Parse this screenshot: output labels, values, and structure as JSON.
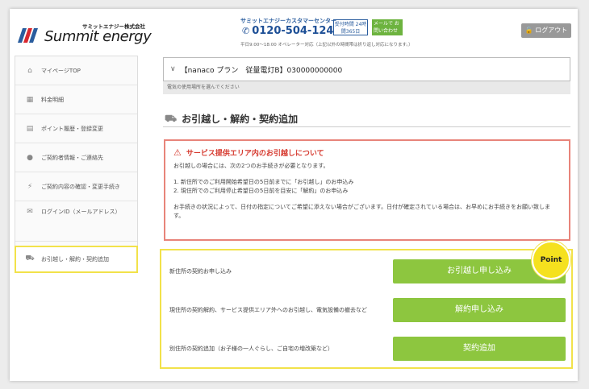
{
  "header": {
    "logo_kana": "サミットエナジー株式会社",
    "logo_brand": "Summit energy",
    "call_center_title": "サミットエナジーカスタマーセンター",
    "phone": "0120-504-124",
    "hours_badge": "受付時間 24時間365日",
    "mail_button": "メールで お問い合わせ",
    "hours_note": "平日9:00～18:00 オペレーター対応（上記以外の時間帯は折り返し対応になります。）",
    "logout_label": "ログアウト"
  },
  "sidebar": {
    "items": [
      {
        "icon": "home-icon",
        "label": "マイページTOP"
      },
      {
        "icon": "bar-chart-icon",
        "label": "料金明細"
      },
      {
        "icon": "card-icon",
        "label": "ポイント履歴・登録変更"
      },
      {
        "icon": "person-icon",
        "label": "ご契約者情報・ご連絡先"
      },
      {
        "icon": "lightning-icon",
        "label": "ご契約内容の確認・変更手続き"
      },
      {
        "icon": "mail-icon",
        "label": "ログインID（メールアドレス）"
      },
      {
        "icon": "truck-icon",
        "label": "お引越し・解約・契約追加"
      }
    ]
  },
  "contract": {
    "selected": "【nanaco プラン　従量電灯B】030000000000",
    "hint": "電気の使用場所を選んでください"
  },
  "page_title": "お引越し・解約・契約追加",
  "notice": {
    "heading": "サービス提供エリア内のお引越しについて",
    "lead": "お引越しの場合には、次の2つのお手続きが必要となります。",
    "list_1": "1. 新住所でのご利用開始希望日の5日前までに「お引越し」のお申込み",
    "list_2": "2. 現住所でのご利用停止希望日の5日前を目安に「解約」のお申込み",
    "foot": "お手続きの状況によって、日付の指定についてご希望に添えない場合がございます。日付が確定されている場合は、お早めにお手続きをお願い致します。"
  },
  "actions": [
    {
      "label": "新住所の契約お申し込み",
      "button": "お引越し申し込み"
    },
    {
      "label": "現住所の契約解約、サービス提供エリア外へのお引越し、電気設備の撤去など",
      "button": "解約申し込み"
    },
    {
      "label": "別住所の契約追加（お子様の一人ぐらし、ご自宅の増改築など）",
      "button": "契約追加"
    }
  ],
  "point_badge": "Point",
  "colors": {
    "brand_blue": "#1d4f96",
    "action_green": "#8dc63f",
    "highlight_yellow": "#f2e24a",
    "warning_red": "#d63a2f"
  }
}
